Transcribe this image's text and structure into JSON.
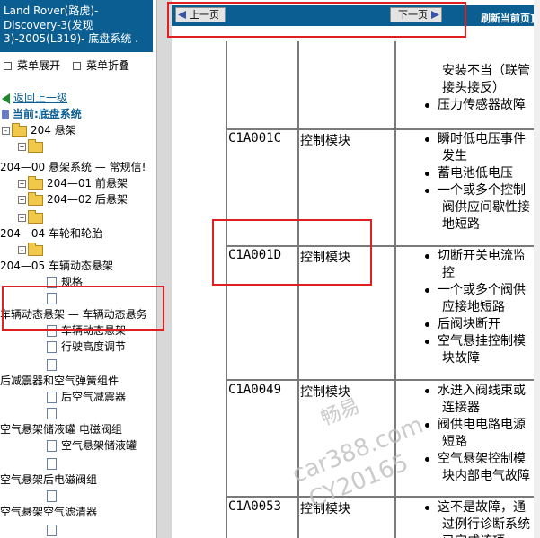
{
  "left": {
    "title_lines": [
      "Land Rover(路虎)-",
      "Discovery-3(发现",
      "3)-2005(L319)- 底盘系统 ."
    ],
    "expand_all": "菜单展开",
    "collapse_all": "菜单折叠",
    "back": "返回上一级",
    "current": "当前:底盘系统",
    "tree": [
      {
        "label": "204 悬架",
        "kind": "folder",
        "pm": "-"
      },
      {
        "label": "",
        "kind": "folder",
        "pm": "+"
      },
      {
        "label": "204—00 悬架系统 — 常规信!",
        "kind": "text"
      },
      {
        "label": "204—01 前悬架",
        "kind": "folder",
        "pm": "+"
      },
      {
        "label": "204—02 后悬架",
        "kind": "folder",
        "pm": "+"
      },
      {
        "label": "",
        "kind": "folder",
        "pm": "+"
      },
      {
        "label": "204—04 车轮和轮胎",
        "kind": "text"
      },
      {
        "label": "",
        "kind": "folder",
        "pm": "-"
      },
      {
        "label": "204—05 车辆动态悬架",
        "kind": "text"
      },
      {
        "label": "规格",
        "kind": "doc"
      },
      {
        "label": "",
        "kind": "doc"
      },
      {
        "label": "车辆动态悬架 — 车辆动态悬务",
        "kind": "text"
      },
      {
        "label": "车辆动态悬架",
        "kind": "doc"
      },
      {
        "label": "行驶高度调节",
        "kind": "doc"
      },
      {
        "label": "",
        "kind": "doc"
      },
      {
        "label": "后减震器和空气弹簧组件",
        "kind": "text"
      },
      {
        "label": "后空气减震器",
        "kind": "doc"
      },
      {
        "label": "",
        "kind": "doc"
      },
      {
        "label": "空气悬架储液罐 电磁阀组",
        "kind": "text"
      },
      {
        "label": "空气悬架储液罐",
        "kind": "doc"
      },
      {
        "label": "",
        "kind": "doc"
      },
      {
        "label": "空气悬架后电磁阀组",
        "kind": "text"
      },
      {
        "label": "",
        "kind": "doc"
      },
      {
        "label": "空气悬架空气滤清器",
        "kind": "text"
      },
      {
        "label": "",
        "kind": "doc"
      }
    ]
  },
  "topbar": {
    "prev": "上一页",
    "next": "下一页",
    "refresh": "刷新当前页]"
  },
  "table": {
    "rows": [
      {
        "code": "",
        "component": "",
        "causes": [
          {
            "bullet": false,
            "lines": [
              "安装不当（联管",
              "接头接反）"
            ]
          },
          {
            "bullet": true,
            "lines": [
              "压力传感器故障"
            ]
          }
        ]
      },
      {
        "code": "C1A001C",
        "component": "控制模块",
        "causes": [
          {
            "bullet": true,
            "lines": [
              "瞬时低电压事件",
              "发生"
            ]
          },
          {
            "bullet": true,
            "lines": [
              "蓄电池低电压"
            ]
          },
          {
            "bullet": true,
            "lines": [
              "一个或多个控制",
              "阀供应间歇性接",
              "地短路"
            ]
          }
        ]
      },
      {
        "code": "C1A001D",
        "component": "控制模块",
        "causes": [
          {
            "bullet": true,
            "lines": [
              "切断开关电流监",
              "控"
            ]
          },
          {
            "bullet": true,
            "lines": [
              "一个或多个阀供",
              "应接地短路"
            ]
          },
          {
            "bullet": true,
            "lines": [
              "后阀块断开"
            ]
          },
          {
            "bullet": true,
            "lines": [
              "空气悬挂控制模",
              "块故障"
            ]
          }
        ]
      },
      {
        "code": "C1A0049",
        "component": "控制模块",
        "causes": [
          {
            "bullet": true,
            "lines": [
              "水进入阀线束或",
              "连接器"
            ]
          },
          {
            "bullet": true,
            "lines": [
              "阀供电电路电源",
              "短路"
            ]
          },
          {
            "bullet": true,
            "lines": [
              "空气悬架控制模",
              "块内部电气故障"
            ]
          }
        ]
      },
      {
        "code": "C1A0053",
        "component": "控制模块",
        "causes": [
          {
            "bullet": true,
            "lines": [
              "这不是故障，通",
              "过例行诊断系统",
              "已完成该项"
            ]
          }
        ]
      }
    ]
  },
  "watermark": [
    "畅易",
    "car388.com",
    "CY20165"
  ]
}
